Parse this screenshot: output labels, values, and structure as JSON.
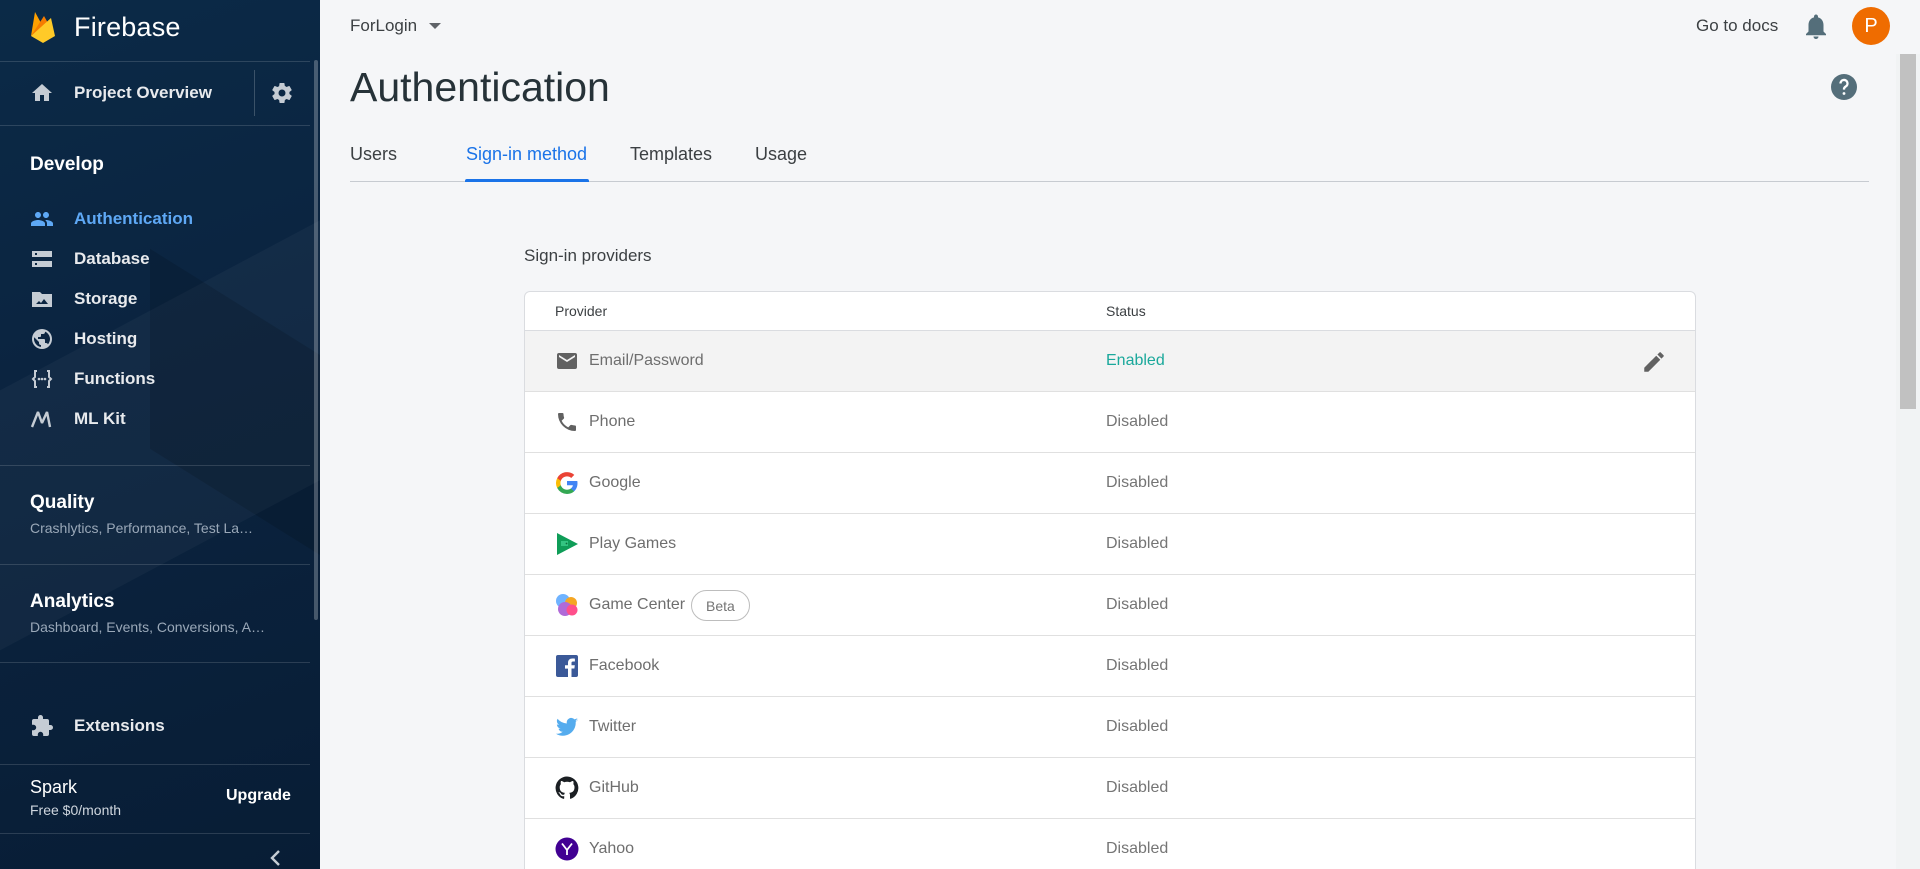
{
  "app": {
    "brand": "Firebase",
    "project_overview": "Project Overview"
  },
  "sidebar": {
    "develop_title": "Develop",
    "develop_items": [
      {
        "label": "Authentication",
        "icon": "people-icon",
        "active": true
      },
      {
        "label": "Database",
        "icon": "database-icon",
        "active": false
      },
      {
        "label": "Storage",
        "icon": "storage-icon",
        "active": false
      },
      {
        "label": "Hosting",
        "icon": "globe-icon",
        "active": false
      },
      {
        "label": "Functions",
        "icon": "functions-icon",
        "active": false
      },
      {
        "label": "ML Kit",
        "icon": "ml-kit-icon",
        "active": false
      }
    ],
    "quality": {
      "title": "Quality",
      "subtitle": "Crashlytics, Performance, Test La…"
    },
    "analytics": {
      "title": "Analytics",
      "subtitle": "Dashboard, Events, Conversions, A…"
    },
    "extensions": "Extensions",
    "plan": {
      "name": "Spark",
      "price": "Free $0/month",
      "upgrade": "Upgrade"
    }
  },
  "topbar": {
    "project": "ForLogin",
    "docs": "Go to docs",
    "avatar_letter": "P"
  },
  "page": {
    "title": "Authentication",
    "tabs": [
      "Users",
      "Sign-in method",
      "Templates",
      "Usage"
    ],
    "active_tab": "Sign-in method"
  },
  "providers": {
    "heading": "Sign-in providers",
    "col_provider": "Provider",
    "col_status": "Status",
    "rows": [
      {
        "name": "Email/Password",
        "status": "Enabled",
        "icon": "email-icon"
      },
      {
        "name": "Phone",
        "status": "Disabled",
        "icon": "phone-icon"
      },
      {
        "name": "Google",
        "status": "Disabled",
        "icon": "google-icon"
      },
      {
        "name": "Play Games",
        "status": "Disabled",
        "icon": "play-games-icon"
      },
      {
        "name": "Game Center",
        "status": "Disabled",
        "icon": "game-center-icon",
        "badge": "Beta"
      },
      {
        "name": "Facebook",
        "status": "Disabled",
        "icon": "facebook-icon"
      },
      {
        "name": "Twitter",
        "status": "Disabled",
        "icon": "twitter-icon"
      },
      {
        "name": "GitHub",
        "status": "Disabled",
        "icon": "github-icon"
      },
      {
        "name": "Yahoo",
        "status": "Disabled",
        "icon": "yahoo-icon"
      }
    ]
  },
  "colors": {
    "sidebar_bg": "#0b2a47",
    "accent": "#1a73e8",
    "active_nav": "#5ea8f5",
    "enabled": "#1aa89b",
    "avatar": "#ef6c00"
  }
}
